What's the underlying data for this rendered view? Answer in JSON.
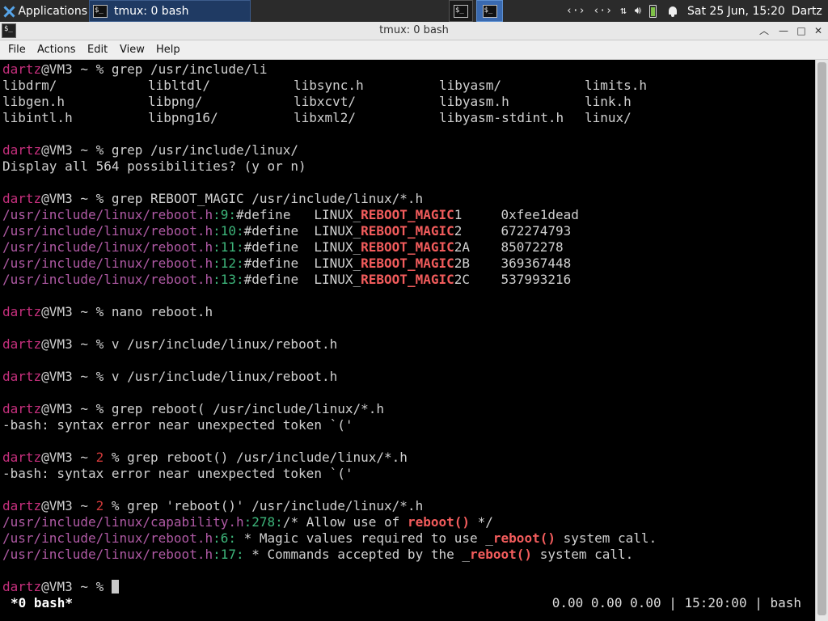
{
  "panel": {
    "applications_label": "Applications",
    "task_title": "tmux: 0 bash",
    "clock": "Sat 25 Jun, 15:20",
    "user": "Dartz"
  },
  "window": {
    "title": "tmux: 0 bash"
  },
  "menubar": {
    "items": [
      "File",
      "Actions",
      "Edit",
      "View",
      "Help"
    ]
  },
  "terminal": {
    "user": "dartz",
    "hostsep": "@VM3 ~ ",
    "cmd1": "% grep /usr/include/li",
    "compl": [
      [
        "libdrm/",
        "libltdl/",
        "libsync.h",
        "libyasm/",
        "limits.h"
      ],
      [
        "libgen.h",
        "libpng/",
        "libxcvt/",
        "libyasm.h",
        "link.h"
      ],
      [
        "libintl.h",
        "libpng16/",
        "libxml2/",
        "libyasm-stdint.h",
        "linux/"
      ]
    ],
    "cmd2": "% grep /usr/include/linux/",
    "prompt_possibilities": "Display all 564 possibilities? (y or n)",
    "cmd3": "% grep REBOOT_MAGIC /usr/include/linux/*.h",
    "reboot_path": "/usr/include/linux/reboot.h",
    "magic_rows": [
      {
        "line": "9",
        "pre": "#define   LINUX_",
        "match": "REBOOT_MAGIC",
        "post": "1     0xfee1dead"
      },
      {
        "line": "10",
        "pre": "#define  LINUX_",
        "match": "REBOOT_MAGIC",
        "post": "2     672274793"
      },
      {
        "line": "11",
        "pre": "#define  LINUX_",
        "match": "REBOOT_MAGIC",
        "post": "2A    85072278"
      },
      {
        "line": "12",
        "pre": "#define  LINUX_",
        "match": "REBOOT_MAGIC",
        "post": "2B    369367448"
      },
      {
        "line": "13",
        "pre": "#define  LINUX_",
        "match": "REBOOT_MAGIC",
        "post": "2C    537993216"
      }
    ],
    "cmd4": "% nano reboot.h",
    "cmd5": "% v /usr/include/linux/reboot.h",
    "cmd6": "% v /usr/include/linux/reboot.h",
    "cmd7": "% grep reboot( /usr/include/linux/*.h",
    "error1": "-bash: syntax error near unexpected token `('",
    "exit_code": "2",
    "cmd8_rest": "% grep reboot() /usr/include/linux/*.h",
    "error2": "-bash: syntax error near unexpected token `('",
    "cmd9_rest": "% grep 'reboot()' /usr/include/linux/*.h",
    "cap_path": "/usr/include/linux/capability.h",
    "cap_line": "278",
    "cap_pre": "/* Allow use of ",
    "cap_match": "reboot()",
    "cap_post": " */",
    "res2_line": "6",
    "res2_pre": " * Magic values required to use _",
    "res2_match": "reboot()",
    "res2_post": " system call.",
    "res3_line": "17",
    "res3_pre": " * Commands accepted by the _",
    "res3_match": "reboot()",
    "res3_post": " system call.",
    "final_prompt": "% "
  },
  "tmux": {
    "status_left": "*0 bash*",
    "status_right": "0.00 0.00 0.00 | 15:20:00 | bash"
  }
}
